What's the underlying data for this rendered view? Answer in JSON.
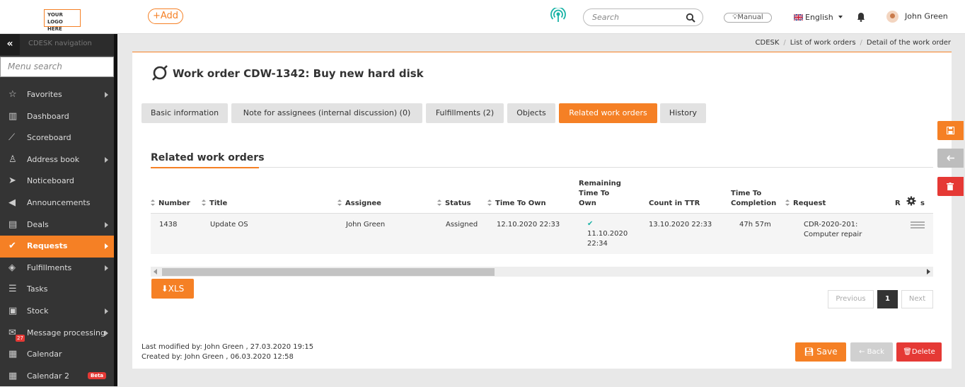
{
  "topbar": {
    "logo_line1": "YOUR LOGO",
    "logo_line2": "HERE",
    "add_label": "+Add",
    "search_placeholder": "Search",
    "manual_label": "Manual",
    "language": "English",
    "user_name": "John Green"
  },
  "sidebar": {
    "title": "CDESK navigation",
    "menu_search_placeholder": "Menu search",
    "items": [
      {
        "label": "Favorites",
        "icon": "star-icon",
        "arrow": true
      },
      {
        "label": "Dashboard",
        "icon": "bar-chart-icon",
        "arrow": false
      },
      {
        "label": "Scoreboard",
        "icon": "line-chart-icon",
        "arrow": false
      },
      {
        "label": "Address book",
        "icon": "user-icon",
        "arrow": true
      },
      {
        "label": "Noticeboard",
        "icon": "paper-plane-icon",
        "arrow": false
      },
      {
        "label": "Announcements",
        "icon": "megaphone-icon",
        "arrow": false
      },
      {
        "label": "Deals",
        "icon": "deals-icon",
        "arrow": true
      },
      {
        "label": "Requests",
        "icon": "check-circle-icon",
        "arrow": true,
        "active": true
      },
      {
        "label": "Fulfillments",
        "icon": "cube-icon",
        "arrow": true
      },
      {
        "label": "Tasks",
        "icon": "tasks-icon",
        "arrow": false
      },
      {
        "label": "Stock",
        "icon": "stock-icon",
        "arrow": true
      },
      {
        "label": "Message processing",
        "icon": "envelope-icon",
        "arrow": true,
        "badge": "27"
      },
      {
        "label": "Calendar",
        "icon": "calendar-icon",
        "arrow": false
      },
      {
        "label": "Calendar 2",
        "icon": "calendar-icon",
        "arrow": false,
        "beta": "Beta"
      }
    ]
  },
  "breadcrumbs": [
    "CDESK",
    "List of work orders",
    "Detail of the work order"
  ],
  "page": {
    "title": "Work order CDW-1342: Buy new hard disk",
    "tabs": [
      {
        "label": "Basic information",
        "active": false
      },
      {
        "label": "Note for assignees (internal discussion) (0)",
        "active": false
      },
      {
        "label": "Fulfillments (2)",
        "active": false
      },
      {
        "label": "Objects",
        "active": false
      },
      {
        "label": "Related work orders",
        "active": true
      },
      {
        "label": "History",
        "active": false
      }
    ],
    "section_title": "Related work orders"
  },
  "table": {
    "headers": {
      "number": "Number",
      "title": "Title",
      "assignee": "Assignee",
      "status": "Status",
      "time_to_own": "Time To Own",
      "remaining_1": "Remaining",
      "remaining_2": "Time To",
      "remaining_3": "Own",
      "count_ttr": "Count in TTR",
      "completion_1": "Time To",
      "completion_2": "Completion",
      "request": "Request",
      "r_col": "R",
      "s_col": "s"
    },
    "rows": [
      {
        "number": "1438",
        "title": "Update OS",
        "assignee": "John Green",
        "status": "Assigned",
        "time_to_own": "12.10.2020 22:33",
        "remaining_date": "11.10.2020",
        "remaining_time": "22:34",
        "count_ttr": "13.10.2020 22:33",
        "completion": "47h 57m",
        "request_1": "CDR-2020-201:",
        "request_2": "Computer repair"
      }
    ]
  },
  "export_label": "XLS",
  "pagination": {
    "previous": "Previous",
    "current": "1",
    "next": "Next"
  },
  "footer": {
    "modified": "Last modified by:  John Green , 27.03.2020 19:15",
    "created": "Created by:  John Green , 06.03.2020 12:58",
    "save": "Save",
    "back": "Back",
    "delete": "Delete"
  },
  "colors": {
    "accent": "#f58025",
    "danger": "#e53935",
    "sidebar": "#343434"
  }
}
